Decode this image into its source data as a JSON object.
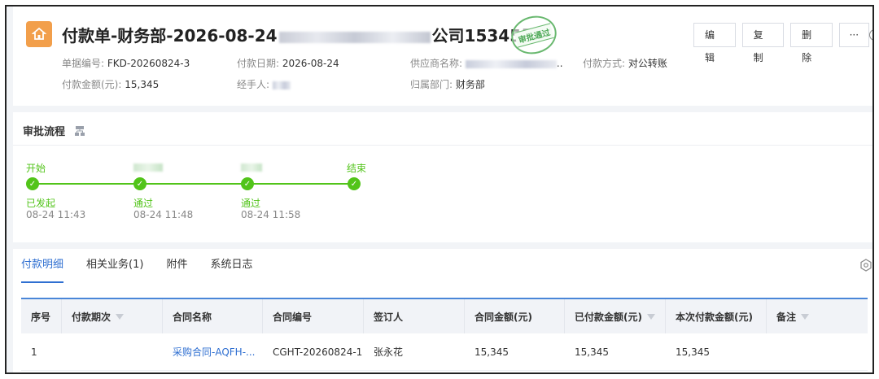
{
  "header": {
    "title_prefix": "付款单-财务部-2026-08-24",
    "title_suffix": "公司15345元",
    "stamp_text": "审批通过",
    "buttons": {
      "edit": "编辑",
      "copy": "复制",
      "delete": "删除",
      "more": "···"
    },
    "fields": {
      "doc_no_label": "单据编号:",
      "doc_no": "FKD-20260824-3",
      "pay_date_label": "付款日期:",
      "pay_date": "2026-08-24",
      "supplier_label": "供应商名称:",
      "supplier_tail": "..",
      "pay_method_label": "付款方式:",
      "pay_method": "对公转账",
      "amount_label": "付款金额(元):",
      "amount": "15,345",
      "handler_label": "经手人:",
      "dept_label": "归属部门:",
      "dept": "财务部"
    }
  },
  "approval": {
    "title": "审批流程",
    "nodes": [
      {
        "name": "开始",
        "status": "已发起",
        "time": "08-24 11:43"
      },
      {
        "name": "",
        "status": "通过",
        "time": "08-24 11:48"
      },
      {
        "name": "",
        "status": "通过",
        "time": "08-24 11:58"
      },
      {
        "name": "结束",
        "status": "",
        "time": ""
      }
    ]
  },
  "detail": {
    "tabs": [
      "付款明细",
      "相关业务(1)",
      "附件",
      "系统日志"
    ],
    "columns": [
      "序号",
      "付款期次",
      "合同名称",
      "合同编号",
      "签订人",
      "合同金额(元)",
      "已付款金额(元)",
      "本次付款金额(元)",
      "备注"
    ],
    "rows": [
      {
        "no": "1",
        "period": "",
        "contract_name": "采购合同-AQFH-...",
        "contract_no": "CGHT-20260824-1",
        "signer": "张永花",
        "contract_amount": "15,345",
        "paid": "15,345",
        "current": "15,345",
        "remark": ""
      }
    ]
  },
  "colors": {
    "accent": "#2f6fd1",
    "success": "#52c41a",
    "home_icon_bg": "#f29f4b"
  }
}
